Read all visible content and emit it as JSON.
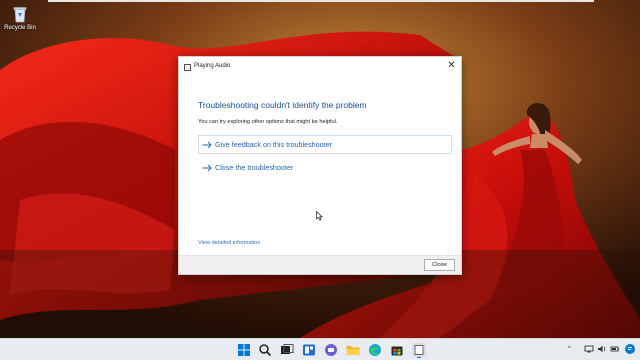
{
  "desktop": {
    "recycle_bin_label": "Recycle Bin"
  },
  "dialog": {
    "title": "Playing Audio",
    "heading": "Troubleshooting couldn't identify the problem",
    "subtext": "You can try exploring other options that might be helpful.",
    "options": [
      {
        "label": "Give feedback on this troubleshooter"
      },
      {
        "label": "Close the troubleshooter"
      }
    ],
    "details_link": "View detailed information",
    "close_button": "Close",
    "close_glyph": "✕"
  },
  "taskbar": {
    "icons": [
      "windows-start-icon",
      "search-icon",
      "task-view-icon",
      "widgets-icon",
      "chat-icon",
      "file-explorer-icon",
      "edge-icon",
      "store-icon",
      "troubleshooter-app-icon"
    ],
    "tray_chevron": "^"
  },
  "colors": {
    "heading": "#1a4f8c",
    "link": "#2367b3",
    "taskbar": "#e8ebf0",
    "accent": "#0078d4"
  }
}
